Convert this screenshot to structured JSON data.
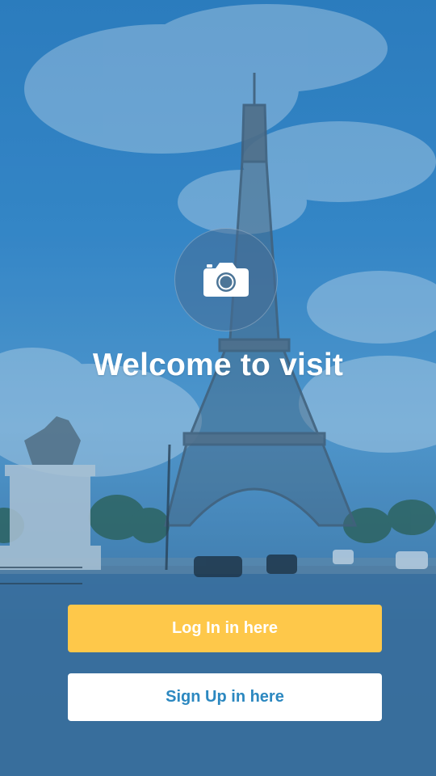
{
  "welcome": {
    "title": "Welcome to visit"
  },
  "buttons": {
    "login_label": "Log In in here",
    "signup_label": "Sign Up in here"
  },
  "icons": {
    "camera": "camera-icon"
  },
  "colors": {
    "overlay": "#2f7fc0",
    "login_button_bg": "#fec84a",
    "login_button_text": "#ffffff",
    "signup_button_bg": "#ffffff",
    "signup_button_text": "#2c88c0"
  }
}
